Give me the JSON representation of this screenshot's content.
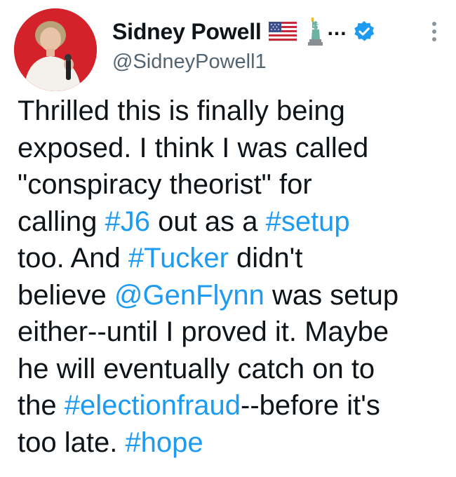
{
  "author": {
    "display_name": "Sidney Powell",
    "name_ellipsis": "...",
    "handle": "@SidneyPowell1",
    "verified": true
  },
  "icons": {
    "flag": "us-flag-icon",
    "statue": "statue-of-liberty-icon",
    "verified": "verified-badge-icon",
    "more": "more-options-icon"
  },
  "colors": {
    "link": "#1d9bf0",
    "verified": "#1d9bf0",
    "avatar_bg": "#d3222a",
    "text": "#0f1419",
    "handle": "#536471"
  },
  "tweet": {
    "lines": [
      [
        {
          "t": "Thrilled this is finally being"
        }
      ],
      [
        {
          "t": "exposed. I think I was called"
        }
      ],
      [
        {
          "t": "\"conspiracy theorist\" for"
        }
      ],
      [
        {
          "t": "calling "
        },
        {
          "t": "#J6",
          "link": true
        },
        {
          "t": " out as a "
        },
        {
          "t": "#setup",
          "link": true
        }
      ],
      [
        {
          "t": "too. And "
        },
        {
          "t": "#Tucker",
          "link": true
        },
        {
          "t": " didn't"
        }
      ],
      [
        {
          "t": "believe "
        },
        {
          "t": "@GenFlynn",
          "link": true
        },
        {
          "t": " was setup"
        }
      ],
      [
        {
          "t": "either--until I proved it. Maybe"
        }
      ],
      [
        {
          "t": "he will eventually catch on to"
        }
      ],
      [
        {
          "t": "the "
        },
        {
          "t": "#electionfraud",
          "link": true
        },
        {
          "t": "--before it's"
        }
      ],
      [
        {
          "t": "too late. "
        },
        {
          "t": "#hope",
          "link": true
        }
      ]
    ]
  }
}
